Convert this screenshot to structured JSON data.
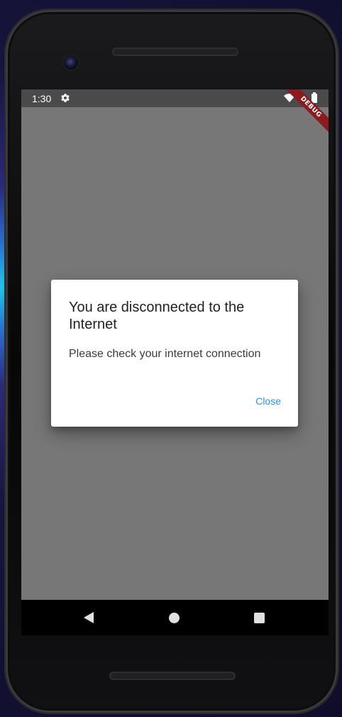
{
  "status_bar": {
    "time": "1:30",
    "icons": [
      "gear-icon",
      "wifi-icon",
      "battery-icon"
    ]
  },
  "debug_banner": {
    "label": "DEBUG"
  },
  "dialog": {
    "title": "You are disconnected to the Internet",
    "message": "Please check your internet connection",
    "close_label": "Close"
  },
  "nav_bar": {
    "icons": [
      "back-icon",
      "home-icon",
      "recents-icon"
    ]
  },
  "colors": {
    "accent": "#2196f3",
    "scrim": "#777777",
    "debug_banner": "#8b1b1d"
  }
}
